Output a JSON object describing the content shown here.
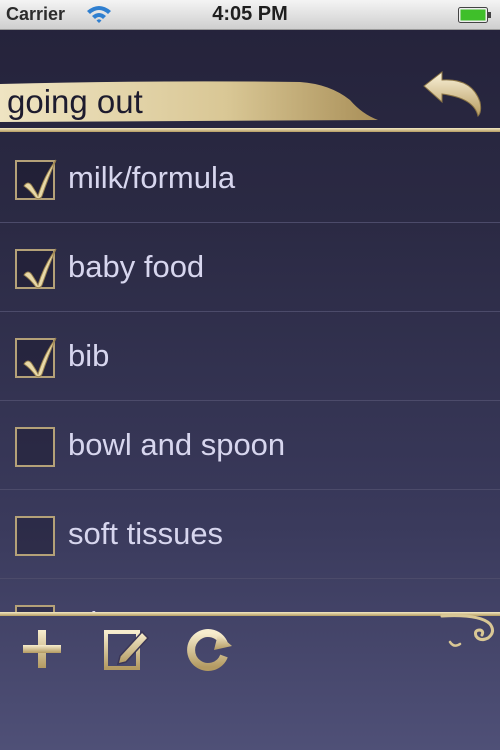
{
  "status_bar": {
    "carrier": "Carrier",
    "time": "4:05 PM",
    "battery_color": "#3fbf2a"
  },
  "header": {
    "title": "going out",
    "back_icon": "back-arrow-icon"
  },
  "list": {
    "items": [
      {
        "label": "milk/formula",
        "checked": true
      },
      {
        "label": "baby food",
        "checked": true
      },
      {
        "label": "bib",
        "checked": true
      },
      {
        "label": "bowl and spoon",
        "checked": false
      },
      {
        "label": "soft tissues",
        "checked": false
      },
      {
        "label": "wipes",
        "checked": false
      }
    ]
  },
  "toolbar": {
    "add_icon": "plus-icon",
    "edit_icon": "edit-icon",
    "reset_icon": "refresh-icon"
  },
  "colors": {
    "gold_light": "#f3e8c5",
    "gold_dark": "#b59c62",
    "background_top": "#24223a",
    "background_bottom": "#4f5077",
    "item_text": "#d7d6ee"
  }
}
